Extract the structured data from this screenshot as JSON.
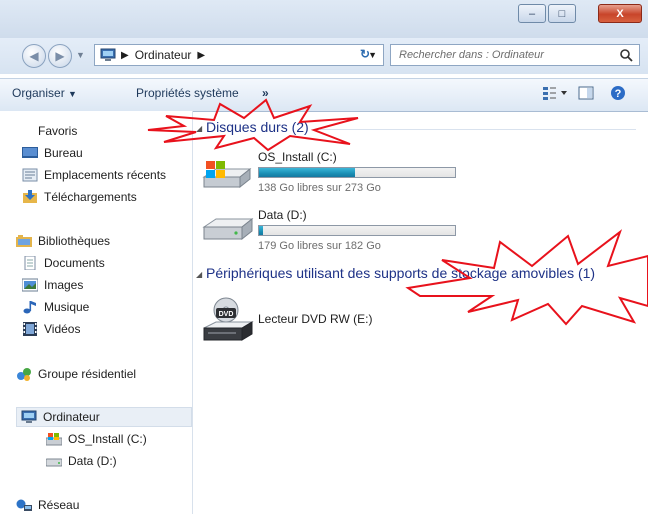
{
  "window": {
    "buttons": {
      "minimize": "–",
      "maximize": "□",
      "close": "X"
    }
  },
  "address": {
    "path": [
      "Ordinateur"
    ],
    "search_placeholder": "Rechercher dans : Ordinateur"
  },
  "toolbar": {
    "organize_label": "Organiser",
    "system_props_label": "Propriétés système",
    "more_label": "»"
  },
  "nav": {
    "favorites_label": "Favoris",
    "favorites": [
      "Bureau",
      "Emplacements récents",
      "Téléchargements"
    ],
    "libraries_label": "Bibliothèques",
    "libraries": [
      "Documents",
      "Images",
      "Musique",
      "Vidéos"
    ],
    "homegroup_label": "Groupe résidentiel",
    "computer_label": "Ordinateur",
    "computer_items": [
      "OS_Install (C:)",
      "Data (D:)"
    ],
    "network_label": "Réseau"
  },
  "content": {
    "hard_disks_header": "Disques durs (2)",
    "drives": [
      {
        "name": "OS_Install (C:)",
        "free_text": "138 Go libres sur 273 Go",
        "used_fraction": 0.49
      },
      {
        "name": "Data (D:)",
        "free_text": "179 Go libres sur 182 Go",
        "used_fraction": 0.02
      }
    ],
    "removable_header": "Périphériques utilisant des supports de stockage amovibles (1)",
    "removable": [
      {
        "name": "Lecteur DVD RW (E:)",
        "icon_text": "DVD"
      }
    ]
  },
  "colors": {
    "accent": "#1e3287",
    "annotation": "#e8121c",
    "bar_fill": "#1b8fb5"
  },
  "icons": [
    "back-arrow-icon",
    "forward-arrow-icon",
    "computer-icon",
    "refresh-icon",
    "search-icon",
    "view-options-icon",
    "preview-pane-icon",
    "help-icon",
    "star-icon",
    "desktop-icon",
    "recent-places-icon",
    "downloads-icon",
    "libraries-icon",
    "document-icon",
    "images-icon",
    "music-icon",
    "videos-icon",
    "homegroup-icon",
    "hard-drive-icon",
    "windows-drive-icon",
    "dvd-drive-icon",
    "network-icon"
  ]
}
